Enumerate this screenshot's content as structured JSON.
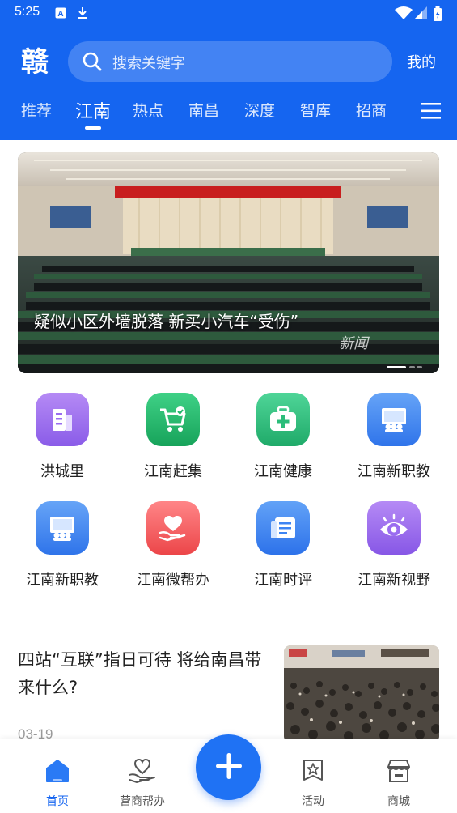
{
  "status_bar": {
    "time": "5:25"
  },
  "header": {
    "logo_text": "赣",
    "search_placeholder": "搜索关键字",
    "mine_label": "我的",
    "tabs": [
      {
        "label": "推荐",
        "active": false
      },
      {
        "label": "江南",
        "active": true
      },
      {
        "label": "热点",
        "active": false
      },
      {
        "label": "南昌",
        "active": false
      },
      {
        "label": "深度",
        "active": false
      },
      {
        "label": "智库",
        "active": false
      },
      {
        "label": "招商",
        "active": false
      }
    ]
  },
  "banner": {
    "title": "疑似小区外墙脱落 新买小汽车“受伤”",
    "watermark": "新闻",
    "pages": 3,
    "current_page": 1
  },
  "grid": [
    {
      "label": "洪城里",
      "icon": "building-icon",
      "color": "#9b6cf0"
    },
    {
      "label": "江南赶集",
      "icon": "shopping-cart-icon",
      "color": "#21b66a"
    },
    {
      "label": "江南健康",
      "icon": "medical-kit-icon",
      "color": "#2bbd7a"
    },
    {
      "label": "江南新职教",
      "icon": "classroom-icon",
      "color": "#3f86f2"
    },
    {
      "label": "江南新职教",
      "icon": "classroom-icon",
      "color": "#3f86f2"
    },
    {
      "label": "江南微帮办",
      "icon": "heart-hand-icon",
      "color": "#f05a5e"
    },
    {
      "label": "江南时评",
      "icon": "newspaper-icon",
      "color": "#3d84f3"
    },
    {
      "label": "江南新视野",
      "icon": "eye-icon",
      "color": "#9a6cf0"
    }
  ],
  "article": {
    "title": "四站“互联”指日可待 将给南昌带来什么?",
    "date": "03-19"
  },
  "bottom_nav": {
    "items": [
      {
        "label": "首页",
        "icon": "home-icon",
        "active": true
      },
      {
        "label": "营商帮办",
        "icon": "handshake-icon",
        "active": false
      },
      {
        "label": "活动",
        "icon": "badge-star-icon",
        "active": false
      },
      {
        "label": "商城",
        "icon": "store-icon",
        "active": false
      }
    ],
    "fab_icon": "plus-icon"
  },
  "colors": {
    "primary": "#1565f0",
    "text": "#222222",
    "muted": "#9a9a9a"
  }
}
